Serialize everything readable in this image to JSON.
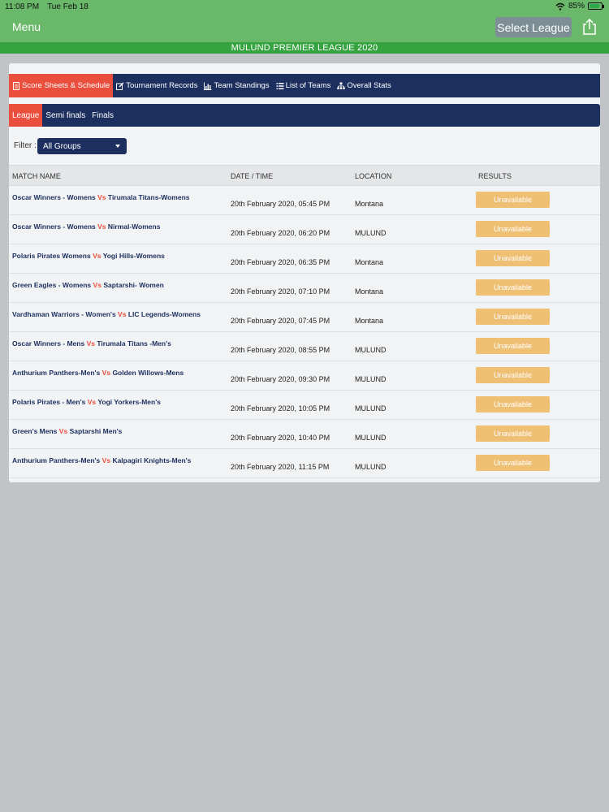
{
  "status_bar": {
    "time": "11:08 PM",
    "date": "Tue Feb 18",
    "battery": "85%"
  },
  "topbar": {
    "menu_label": "Menu",
    "select_league_label": "Select League",
    "share_icon": "share-icon"
  },
  "league_title": "MULUND PREMIER LEAGUE 2020",
  "tabs": [
    {
      "label": "Score Sheets & Schedule",
      "icon": "document-icon"
    },
    {
      "label": "Tournament Records",
      "icon": "edit-icon"
    },
    {
      "label": "Team Standings",
      "icon": "bar-chart-icon"
    },
    {
      "label": "List of Teams",
      "icon": "list-icon"
    },
    {
      "label": "Overall Stats",
      "icon": "hierarchy-icon"
    }
  ],
  "subtabs": [
    {
      "label": "League"
    },
    {
      "label": "Semi finals"
    },
    {
      "label": "Finals"
    }
  ],
  "filter": {
    "label": "Filter :",
    "selected": "All Groups"
  },
  "table": {
    "headers": {
      "match": "MATCH NAME",
      "datetime": "DATE / TIME",
      "location": "LOCATION",
      "results": "RESULTS"
    },
    "vs_label": "Vs",
    "rows": [
      {
        "team1": "Oscar Winners - Womens",
        "team2": "Tirumala Titans-Womens",
        "datetime": "20th February 2020, 05:45 PM",
        "location": "Montana",
        "result": "Unavailable"
      },
      {
        "team1": "Oscar Winners - Womens",
        "team2": "Nirmal-Womens",
        "datetime": "20th February 2020, 06:20 PM",
        "location": "MULUND",
        "result": "Unavailable"
      },
      {
        "team1": "Polaris Pirates Womens",
        "team2": "Yogi Hills-Womens",
        "datetime": "20th February 2020, 06:35 PM",
        "location": "Montana",
        "result": "Unavailable"
      },
      {
        "team1": "Green Eagles - Womens",
        "team2": "Saptarshi- Women",
        "datetime": "20th February 2020, 07:10 PM",
        "location": "Montana",
        "result": "Unavailable"
      },
      {
        "team1": "Vardhaman Warriors - Women's",
        "team2": "LIC Legends-Womens",
        "datetime": "20th February 2020, 07:45 PM",
        "location": "Montana",
        "result": "Unavailable"
      },
      {
        "team1": "Oscar Winners - Mens",
        "team2": "Tirumala Titans -Men's",
        "datetime": "20th February 2020, 08:55 PM",
        "location": "MULUND",
        "result": "Unavailable"
      },
      {
        "team1": "Anthurium Panthers-Men's",
        "team2": "Golden Willows-Mens",
        "datetime": "20th February 2020, 09:30 PM",
        "location": "MULUND",
        "result": "Unavailable"
      },
      {
        "team1": "Polaris Pirates - Men's",
        "team2": "Yogi Yorkers-Men's",
        "datetime": "20th February 2020, 10:05 PM",
        "location": "MULUND",
        "result": "Unavailable"
      },
      {
        "team1": "Green's Mens",
        "team2": "Saptarshi Men's",
        "datetime": "20th February 2020, 10:40 PM",
        "location": "MULUND",
        "result": "Unavailable"
      },
      {
        "team1": "Anthurium Panthers-Men's",
        "team2": "Kalpagiri Knights-Men's",
        "datetime": "20th February 2020, 11:15 PM",
        "location": "MULUND",
        "result": "Unavailable"
      }
    ]
  },
  "colors": {
    "topbar": "#6ab86a",
    "banner": "#36a341",
    "navy": "#1c2f5e",
    "active_tab": "#ea4e3c",
    "result_button": "#efbf73"
  }
}
